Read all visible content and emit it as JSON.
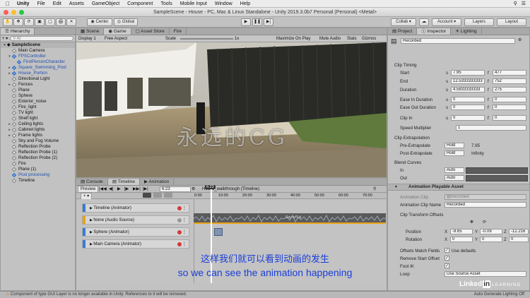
{
  "menubar": {
    "items": [
      "Unity",
      "File",
      "Edit",
      "Assets",
      "GameObject",
      "Component",
      "Tools",
      "Mobile Input",
      "Window",
      "Help"
    ]
  },
  "window": {
    "title": "SampleScene - House - PC, Mac & Linux Standalone - Unity 2019.3.0b7 Personal (Personal) <Metal>"
  },
  "toolbar": {
    "pivot_label": "Center",
    "space_label": "Global",
    "collab_label": "Collab ▾",
    "account_label": "Account ▾",
    "layers_label": "Layers",
    "layout_label": "Layout"
  },
  "hierarchy": {
    "tab_label": "Hierarchy",
    "create_label": "+ ▾",
    "search_placeholder": "All",
    "scene_name": "SampleScene",
    "items": [
      {
        "label": "Main Camera",
        "indent": 1,
        "expander": ""
      },
      {
        "label": "FPSController",
        "indent": 1,
        "expander": "▾",
        "blue": true
      },
      {
        "label": "FirstPersonCharacter",
        "indent": 2,
        "expander": "",
        "blue": true
      },
      {
        "label": "Square_Swimming_Pool",
        "indent": 1,
        "expander": "▸",
        "blue": true
      },
      {
        "label": "House_Portion",
        "indent": 1,
        "expander": "▸",
        "blue": true
      },
      {
        "label": "Directional Light",
        "indent": 1,
        "expander": ""
      },
      {
        "label": "Fences",
        "indent": 1,
        "expander": "▸"
      },
      {
        "label": "Plane",
        "indent": 1,
        "expander": ""
      },
      {
        "label": "Sphere",
        "indent": 1,
        "expander": ""
      },
      {
        "label": "Exterior_noise",
        "indent": 1,
        "expander": ""
      },
      {
        "label": "Fire_light",
        "indent": 1,
        "expander": ""
      },
      {
        "label": "TV light",
        "indent": 1,
        "expander": ""
      },
      {
        "label": "Shelf light",
        "indent": 1,
        "expander": ""
      },
      {
        "label": "Ceiling lights",
        "indent": 1,
        "expander": "▸"
      },
      {
        "label": "Cabinet lights",
        "indent": 1,
        "expander": "▸"
      },
      {
        "label": "Frame lights",
        "indent": 1,
        "expander": "▸"
      },
      {
        "label": "Sky and Fog Volume",
        "indent": 1,
        "expander": ""
      },
      {
        "label": "Reflection Probe",
        "indent": 1,
        "expander": ""
      },
      {
        "label": "Reflection Probe (1)",
        "indent": 1,
        "expander": ""
      },
      {
        "label": "Reflection Probe (2)",
        "indent": 1,
        "expander": ""
      },
      {
        "label": "Fire",
        "indent": 1,
        "expander": ""
      },
      {
        "label": "Plane (1)",
        "indent": 1,
        "expander": ""
      },
      {
        "label": "Post processing",
        "indent": 1,
        "expander": "",
        "blue": true
      },
      {
        "label": "Timeline",
        "indent": 1,
        "expander": ""
      }
    ]
  },
  "game": {
    "tabs": [
      "Scene",
      "Game",
      "Asset Store",
      "Fire"
    ],
    "display": "Display 1",
    "aspect": "Free Aspect",
    "scale_label": "Scale",
    "scale_value": "1x",
    "buttons": [
      "Maximize On Play",
      "Mute Audio",
      "Stats",
      "Gizmos"
    ]
  },
  "timeline": {
    "tabs": [
      "Console",
      "Timeline",
      "Animation"
    ],
    "preview_label": "Preview",
    "frame": "6:23",
    "asset_name": "House_walkthrough (Timeline)",
    "ruler": [
      "0:00",
      "10:00",
      "20:00",
      "30:00",
      "40:00",
      "50:00",
      "60:00",
      "70:00"
    ],
    "playhead_label": "6:23",
    "audio_clip_label": "Say w/Sal",
    "tracks": [
      {
        "label": "Timeline (Animator)",
        "color": "#3a7bd5"
      },
      {
        "label": "None (Audio Source)",
        "color": "#e8a317"
      },
      {
        "label": "Sphere (Animator)",
        "color": "#3a7bd5"
      },
      {
        "label": "Main Camera (Animator)",
        "color": "#3a7bd5"
      }
    ]
  },
  "inspector": {
    "tabs": [
      "Project",
      "Inspector",
      "Lighting"
    ],
    "object_name": "Recorded",
    "clip_timing_header": "Clip Timing",
    "start_label": "Start",
    "start_s": "7.95",
    "start_f": "477",
    "end_label": "End",
    "end_s": "12.5333333333",
    "end_f": "752",
    "duration_label": "Duration",
    "duration_s": "4.5833333333",
    "duration_f": "275",
    "ease_in_label": "Ease In Duration",
    "ease_in_s": "0",
    "ease_in_f": "0",
    "ease_out_label": "Ease Out Duration",
    "ease_out_s": "0",
    "ease_out_f": "0",
    "clip_in_label": "Clip In",
    "clip_in_s": "0",
    "clip_in_f": "0",
    "speed_label": "Speed Multiplier",
    "speed_value": "1",
    "extrapolation_header": "Clip Extrapolation",
    "pre_label": "Pre-Extrapolate",
    "pre_value": "Hold",
    "pre_time": "7.95",
    "post_label": "Post-Extrapolate",
    "post_value": "Hold",
    "post_time": "Infinity",
    "blend_header": "Blend Curves",
    "in_label": "In",
    "in_value": "Auto",
    "out_label": "Out",
    "out_value": "Auto",
    "playable_header": "Animation Playable Asset",
    "anim_clip_label": "Animation Clip",
    "anim_clip_value": "Recorded",
    "anim_clip_name_label": "Animation Clip Name",
    "anim_clip_name_value": "Recorded",
    "offsets_header": "Clip Transform Offsets",
    "position_label": "Position",
    "pos_x": "-9.65",
    "pos_y": "-0.09",
    "pos_z": "-12.216",
    "rotation_label": "Rotation",
    "rot_x": "0",
    "rot_y": "0",
    "rot_z": "0",
    "offsets_match_label": "Offsets Match Fields",
    "use_defaults_label": "Use defaults",
    "remove_offset_label": "Remove Start Offset",
    "foot_ik_label": "Foot IK",
    "loop_label": "Loop",
    "loop_value": "Use Source Asset"
  },
  "statusbar": {
    "message": "Component of type GUI Layer is no longer available in Unity. References to it will be removed.",
    "right": "Auto Generate Lighting Off"
  },
  "overlay": {
    "watermark": "永远的CG",
    "subtitle_cn": "这样我们就可以看到动画的发生",
    "subtitle_en": "so we can see the animation happening",
    "brand_a": "Linked",
    "brand_b": "in",
    "brand_c": "LEARNING"
  },
  "colors": {
    "accent_blue": "#3a7bd5",
    "audio_orange": "#e8a317",
    "subtitle_blue": "#1a3ed8",
    "playhead": "#ffffff"
  }
}
